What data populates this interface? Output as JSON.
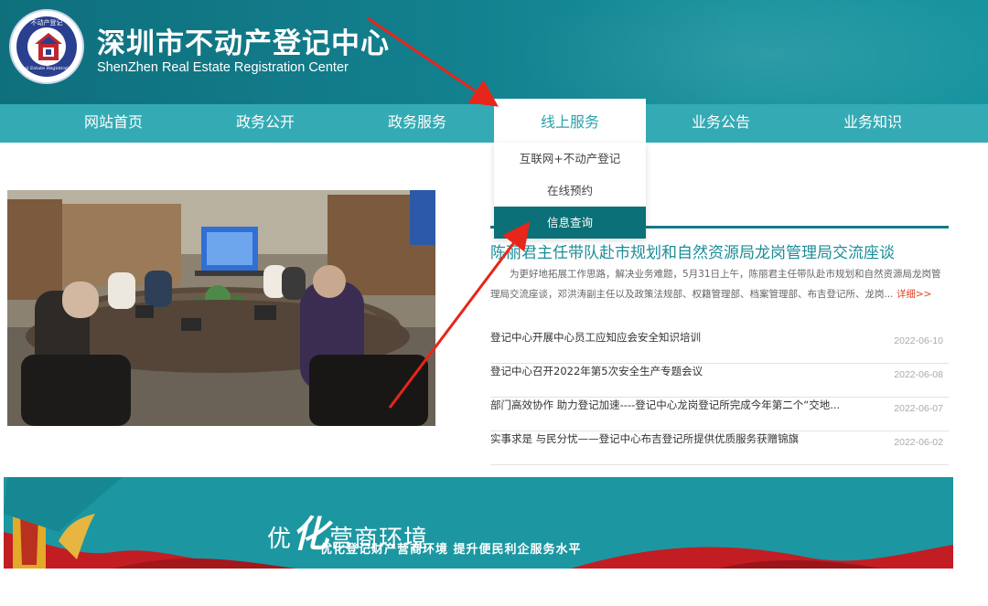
{
  "header": {
    "title_cn": "深圳市不动产登记中心",
    "title_en": "ShenZhen Real Estate Registration Center",
    "logo_top_text": "不动产登记",
    "logo_bottom_text": "Real Estate Registration"
  },
  "nav": {
    "items": [
      {
        "label": "网站首页"
      },
      {
        "label": "政务公开"
      },
      {
        "label": "政务服务"
      },
      {
        "label": "线上服务"
      },
      {
        "label": "业务公告"
      },
      {
        "label": "业务知识"
      }
    ],
    "active_index": 3
  },
  "dropdown": {
    "items": [
      {
        "label": "互联网+不动产登记"
      },
      {
        "label": "在线预约"
      },
      {
        "label": "信息查询"
      }
    ],
    "selected_index": 2
  },
  "featured": {
    "headline": "陈丽君主任带队赴市规划和自然资源局龙岗管理局交流座谈",
    "summary": "为更好地拓展工作思路，解决业务难题，5月31日上午，陈丽君主任带队赴市规划和自然资源局龙岗管理局交流座谈，邓洪涛副主任以及政策法规部、权籍管理部、档案管理部、布吉登记所、龙岗...",
    "more_label": "详细>>"
  },
  "news": [
    {
      "title": "登记中心开展中心员工应知应会安全知识培训",
      "date": "2022-06-10"
    },
    {
      "title": "登记中心召开2022年第5次安全生产专题会议",
      "date": "2022-06-08"
    },
    {
      "title": "部门高效协作 助力登记加速----登记中心龙岗登记所完成今年第二个“交地...",
      "date": "2022-06-07"
    },
    {
      "title": "实事求是 与民分忧——登记中心布吉登记所提供优质服务获赠锦旗",
      "date": "2022-06-02"
    }
  ],
  "banner": {
    "main_prefix": "优",
    "main_big": "化",
    "main_rest": "营商环境",
    "sub": "优化登记财产营商环境 提升便民利企服务水平"
  },
  "colors": {
    "header_teal": "#13808e",
    "nav_teal": "#34aab4",
    "dropdown_selected": "#0b7077",
    "headline": "#1b8d98",
    "more_link": "#e0421f",
    "arrow_red": "#e8251b"
  }
}
